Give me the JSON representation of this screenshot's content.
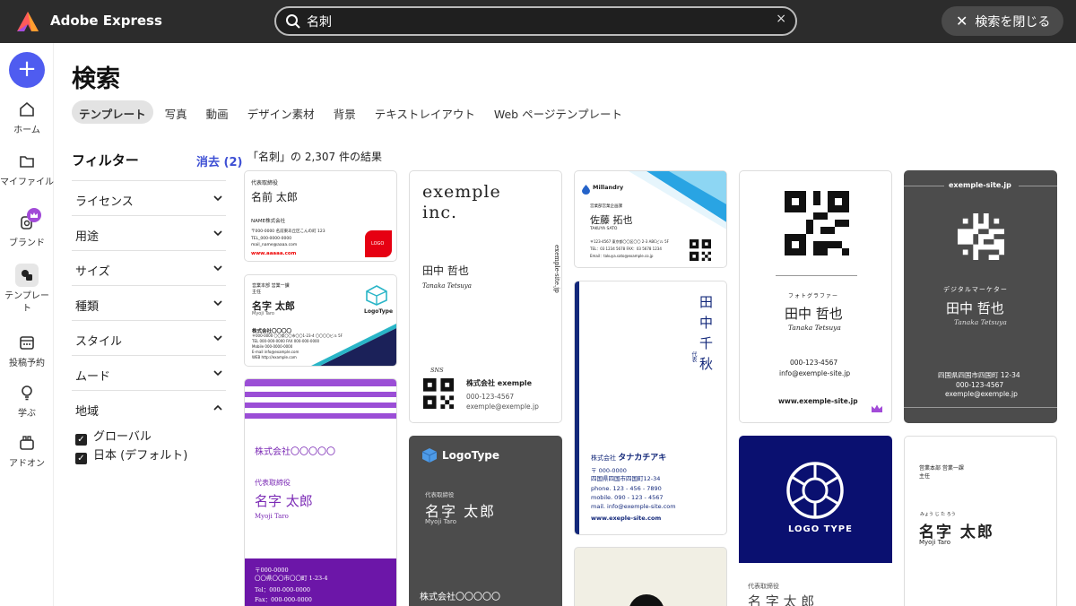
{
  "app": {
    "name": "Adobe Express"
  },
  "search": {
    "value": "名刺",
    "clear_icon": "×"
  },
  "close_search": {
    "label": "検索を閉じる"
  },
  "rail": {
    "create_label": "+",
    "items": [
      {
        "label": "ホーム",
        "icon": "home-icon"
      },
      {
        "label": "マイファイル",
        "icon": "folder-icon"
      },
      {
        "label": "ブランド",
        "icon": "brand-icon"
      },
      {
        "label": "テンプレート",
        "icon": "template-icon"
      },
      {
        "label": "投稿予約",
        "icon": "calendar-icon"
      },
      {
        "label": "学ぶ",
        "icon": "bulb-icon"
      },
      {
        "label": "アドオン",
        "icon": "addon-icon"
      }
    ]
  },
  "page": {
    "title": "検索"
  },
  "tabs": [
    "テンプレート",
    "写真",
    "動画",
    "デザイン素材",
    "背景",
    "テキストレイアウト",
    "Web ページテンプレート"
  ],
  "filters": {
    "heading": "フィルター",
    "clear_label": "消去 (2)",
    "groups": [
      "ライセンス",
      "用途",
      "サイズ",
      "種類",
      "スタイル",
      "ムード",
      "地域"
    ],
    "region_options": [
      "グローバル",
      "日本 (デフォルト)"
    ]
  },
  "results": {
    "summary": "「名刺」の 2,307 件の結果"
  },
  "cards": {
    "c1": {
      "role": "代表取締役",
      "name": "名前 太郎",
      "company": "NAME株式会社",
      "addr": "〒000-0000 名前東あ丘区こんの町 123",
      "tel": "TEL_000-0000-0000",
      "mail": "mail_name@aaaa.com",
      "url": "www.aaaaa.com",
      "logo": "LOGO"
    },
    "c2": {
      "dept": "営業本部 営業一課",
      "title": "主任",
      "name": "名字 太郎",
      "romaji": "Myoji Taro",
      "company": "株式会社〇〇〇〇",
      "addr": "〒000-0000 〇〇県〇〇市〇〇1-23-4 〇〇〇〇ビル 5F",
      "tel": "TEL 000-000-0000   FAX 000-000-0000",
      "mobile": "Mobile 000-0000-0000",
      "mail": "E-mail info@example.com",
      "web": "WEB http://example.com",
      "logo": "LogoType"
    },
    "c3": {
      "company": "株式会社〇〇〇〇〇",
      "role": "代表取締役",
      "name": "名字 太郎",
      "romaji": "Myoji Taro",
      "addr1": "〒000-0000",
      "addr2": "〇〇県〇〇市〇〇町 1-23-4",
      "tel": "Tel：000-000-0000",
      "fax": "Fax：000-000-0000"
    },
    "c4": {
      "logo1": "exemple",
      "logo2": "inc.",
      "name": "田中 哲也",
      "romaji": "Tanaka Tetsuya",
      "site": "exemple-site.jp",
      "sns": "SNS",
      "company": "株式会社 exemple",
      "tel": "000-123-4567",
      "mail": "exemple@exemple.jp"
    },
    "c5": {
      "logo": "LogoType",
      "role": "代表取締役",
      "name": "名字 太郎",
      "romaji": "Myoji Taro",
      "company": "株式会社〇〇〇〇〇"
    },
    "c6": {
      "brand": "Millandry",
      "dept": "営業部営業企画課",
      "name": "佐藤 拓也",
      "romaji": "TAKUYA SATO",
      "addr": "〒123-4567 東京都〇〇区〇〇 2-3 ABCビル 5F",
      "tel": "TEL：03 1234 5678   FAX：03 5678 1234",
      "mail": "Email：takuya.sato@example.co.jp"
    },
    "c7": {
      "name_chars": [
        "田",
        "中",
        "千",
        "秋"
      ],
      "role": "代表",
      "company_prefix": "株式会社",
      "company": "タナカチアキ",
      "addr1": "〒 000-0000",
      "addr2": "四国県四国市四国町12-34",
      "phone": "phone.   123 - 456 - 7890",
      "mobile": "mobile.   090 - 123 - 4567",
      "mail": "mail.     info@exemple-site.com",
      "web": "www.exeple-site.com"
    },
    "c9": {
      "job": "フォトグラファー",
      "name": "田中 哲也",
      "romaji": "Tanaka Tetsuya",
      "tel": "000-123-4567",
      "mail": "info@exemple-site.jp",
      "web": "www.exemple-site.jp"
    },
    "c10": {
      "logo": "LOGO TYPE",
      "role": "代表取締役",
      "name": "名 字 太 郎"
    },
    "c11": {
      "site": "exemple-site.jp",
      "job": "デジタルマーケター",
      "name": "田中 哲也",
      "romaji": "Tanaka Tetsuya",
      "addr": "四国県四国市四国町 12-34",
      "tel": "000-123-4567",
      "mail": "exemple@exemple.jp"
    },
    "c12": {
      "dept": "営業本部 営業一課",
      "title": "主任",
      "ruby": "みょう   じ         た   ろう",
      "name": "名字 太郎",
      "romaji": "Myoji Taro"
    }
  },
  "colors": {
    "accent": "#4f5cf0",
    "topbar": "#2c2c2c",
    "link": "#3d4fd4",
    "purple": "#7b2ab5",
    "navy": "#0a1070",
    "dark_card": "#4c4c4c"
  }
}
